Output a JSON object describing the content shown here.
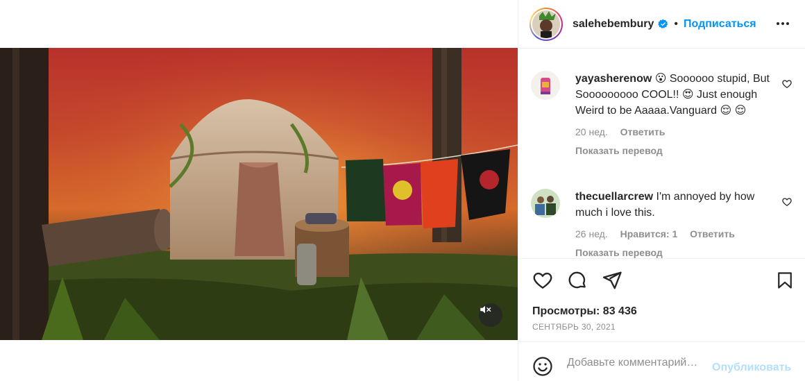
{
  "post": {
    "author": "salehebembury",
    "verified": true,
    "separator": "•",
    "follow_label": "Подписаться",
    "more_icon": "more-horizontal-icon"
  },
  "video": {
    "muted": true,
    "mute_icon": "speaker-muted-icon"
  },
  "comments": [
    {
      "username": "yayasherenow",
      "text": "😮 Soooooo stupid, But Sooooooooo COOL!! 😍 Just enough Weird to be Aaaaa.Vanguard 😌 😌",
      "age": "20 нед.",
      "likes": "",
      "reply": "Ответить",
      "translate": "Показать перевод"
    },
    {
      "username": "thecuellarcrew",
      "text": "I'm annoyed by how much i love this.",
      "age": "26 нед.",
      "likes": "Нравится: 1",
      "reply": "Ответить",
      "translate": "Показать перевод"
    }
  ],
  "actions": {
    "like_icon": "heart-icon",
    "comment_icon": "comment-icon",
    "share_icon": "send-icon",
    "save_icon": "bookmark-icon"
  },
  "stats": {
    "views_label": "Просмотры:",
    "views_value": "83 436",
    "date": "СЕНТЯБРЬ 30, 2021"
  },
  "composer": {
    "emoji_icon": "emoji-icon",
    "placeholder": "Добавьте комментарий…",
    "publish_label": "Опубликовать"
  },
  "colors": {
    "accent": "#0095f6",
    "publish_disabled": "#b2dffc",
    "secondary_text": "#8e8e8e"
  }
}
